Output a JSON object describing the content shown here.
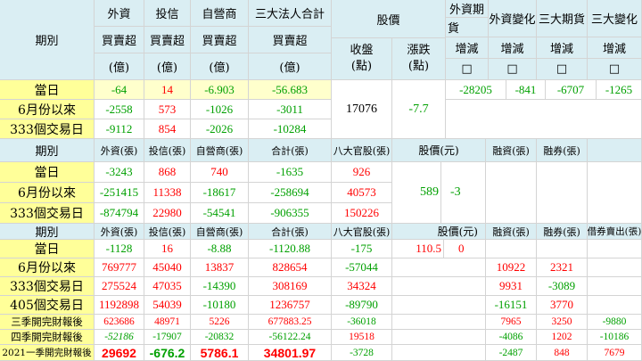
{
  "colors": {
    "negative": "#00a000",
    "positive": "#ff0000",
    "header_bg": "#daeef3",
    "label_bg": "#ffff99"
  },
  "section1": {
    "headers": {
      "period": "期別",
      "foreign": "外資",
      "trust": "投信",
      "dealer": "自營商",
      "total": "三大法人合計",
      "price": "股價",
      "foreign_futures_l1": "外資期",
      "foreign_futures_l2": "貨",
      "foreign_change": "外資變化",
      "big3_futures": "三大期貨",
      "big3_change": "三大變化",
      "net": "買賣超",
      "unit_yi": "(億)",
      "close": "收盤",
      "close_unit": "(點)",
      "change": "漲跌",
      "change_unit": "(點)",
      "inc_dec": "增減",
      "box": "□"
    },
    "rows": [
      {
        "label": "當日",
        "foreign": "-64",
        "trust": "14",
        "dealer": "-6.903",
        "total": "-56.683"
      },
      {
        "label": "6月份以來",
        "foreign": "-2558",
        "trust": "573",
        "dealer": "-1026",
        "total": "-3011"
      },
      {
        "label": "333個交易日",
        "foreign": "-9112",
        "trust": "854",
        "dealer": "-2026",
        "total": "-10284"
      }
    ],
    "close": "17076",
    "change": "-7.7",
    "futures": {
      "foreign": "-28205",
      "foreign_change": "-841",
      "big3": "-6707",
      "big3_change": "-1265"
    }
  },
  "section2": {
    "headers": {
      "period": "期別",
      "foreign": "外資(張)",
      "trust": "投信(張)",
      "dealer": "自營商(張)",
      "total": "合計(張)",
      "eight": "八大官股(張)",
      "price": "股價(元)",
      "margin": "融資(張)",
      "short": "融券(張)"
    },
    "rows": [
      {
        "label": "當日",
        "foreign": "-3243",
        "trust": "868",
        "dealer": "740",
        "total": "-1635",
        "eight": "926"
      },
      {
        "label": "6月份以來",
        "foreign": "-251415",
        "trust": "11338",
        "dealer": "-18617",
        "total": "-258694",
        "eight": "40573"
      },
      {
        "label": "333個交易日",
        "foreign": "-874794",
        "trust": "22980",
        "dealer": "-54541",
        "total": "-906355",
        "eight": "150226"
      }
    ],
    "price": "589",
    "price_change": "-3"
  },
  "section3": {
    "headers": {
      "period": "期別",
      "foreign": "外資(張)",
      "trust": "投信(張)",
      "dealer": "自營商(張)",
      "total": "合計(張)",
      "eight": "八大官股(張)",
      "price": "股價(元)",
      "margin": "融資(張)",
      "short": "融券(張)",
      "borrow": "借券賣出(張)"
    },
    "price": "110.5",
    "price_change": "0",
    "rows": [
      {
        "label": "當日",
        "foreign": "-1128",
        "trust": "16",
        "dealer": "-8.88",
        "total": "-1120.88",
        "eight": "-175",
        "margin": "",
        "short": "",
        "borrow": ""
      },
      {
        "label": "6月份以來",
        "foreign": "769777",
        "trust": "45040",
        "dealer": "13837",
        "total": "828654",
        "eight": "-57044",
        "margin": "10922",
        "short": "2321",
        "borrow": ""
      },
      {
        "label": "333個交易日",
        "foreign": "275524",
        "trust": "47035",
        "dealer": "-14390",
        "total": "308169",
        "eight": "34324",
        "margin": "9931",
        "short": "-3089",
        "borrow": ""
      },
      {
        "label": "405個交易日",
        "foreign": "1192898",
        "trust": "54039",
        "dealer": "-10180",
        "total": "1236757",
        "eight": "-89790",
        "margin": "-16151",
        "short": "3770",
        "borrow": ""
      },
      {
        "label": "三季開完財報後",
        "foreign": "623686",
        "trust": "48971",
        "dealer": "5226",
        "total": "677883.25",
        "eight": "-36018",
        "margin": "7965",
        "short": "3250",
        "borrow": "-9880"
      },
      {
        "label": "四季開完財報後",
        "foreign": "-52186",
        "trust": "-17907",
        "dealer": "-20832",
        "total": "-56122.24",
        "eight": "19518",
        "margin": "-4086",
        "short": "1202",
        "borrow": "-10186"
      },
      {
        "label": "2021一季開完財報後",
        "foreign": "29692",
        "trust": "-676.2",
        "dealer": "5786.1",
        "total": "34801.97",
        "eight": "-3728",
        "margin": "-2487",
        "short": "848",
        "borrow": "7679"
      }
    ]
  }
}
